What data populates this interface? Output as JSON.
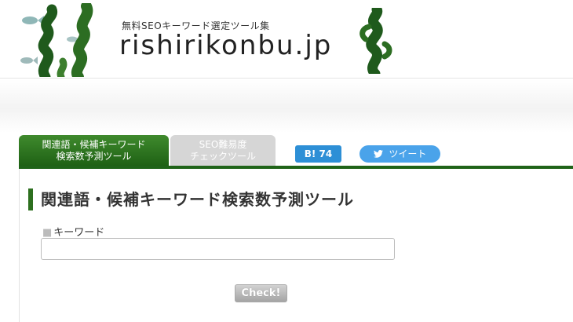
{
  "header": {
    "tagline": "無料SEOキーワード選定ツール集",
    "site_name": "rishirikonbu.jp",
    "logo_left_icon": "seaweed-with-fish-icon",
    "logo_right_icon": "seaweed-icon",
    "brand_color": "#2d6f1f"
  },
  "tabs": [
    {
      "line1": "関連語・候補キーワード",
      "line2": "検索数予測ツール",
      "active": true
    },
    {
      "line1": "SEO難易度",
      "line2": "チェックツール",
      "active": false
    }
  ],
  "share": {
    "hatena_label": "B! 74",
    "tweet_label": "ツイート",
    "tweet_icon": "twitter-bird-icon"
  },
  "main": {
    "title": "関連語・候補キーワード検索数予測ツール",
    "keyword_label": "キーワード",
    "keyword_value": "",
    "check_button": "Check!"
  }
}
